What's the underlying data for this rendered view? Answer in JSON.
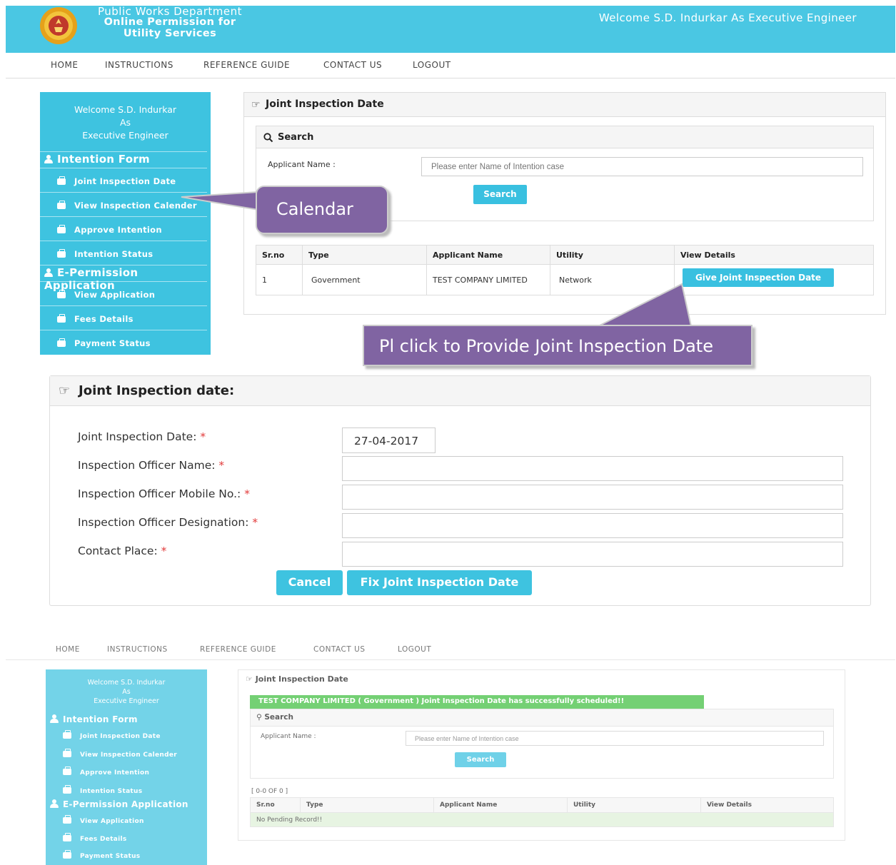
{
  "header": {
    "org_line1": "Public Works Department",
    "org_line2": "Online Permission for",
    "org_line3": "Utility Services",
    "welcome": "Welcome S.D. Indurkar As Executive Engineer"
  },
  "nav": [
    "HOME",
    "INSTRUCTIONS",
    "REFERENCE GUIDE",
    "CONTACT US",
    "LOGOUT"
  ],
  "sidebar": {
    "welcome_line1": "Welcome S.D. Indurkar",
    "welcome_line2": "As",
    "welcome_line3": "Executive Engineer",
    "intention_heading": "Intention Form",
    "intention_items": [
      "Joint Inspection Date",
      "View Inspection Calender",
      "Approve Intention",
      "Intention Status"
    ],
    "epermission_heading": "E-Permission Application",
    "epermission_items": [
      "View Application",
      "Fees Details",
      "Payment Status"
    ]
  },
  "panel": {
    "title": "Joint Inspection Date",
    "search_title": "Search",
    "applicant_label": "Applicant Name :",
    "applicant_placeholder": "Please enter Name of Intention case",
    "search_button": "Search",
    "columns": [
      "Sr.no",
      "Type",
      "Applicant Name",
      "Utility",
      "View Details"
    ],
    "rows": [
      {
        "srno": "1",
        "type": "Government",
        "applicant": "TEST COMPANY LIMITED",
        "utility": "Network",
        "action": "Give Joint Inspection Date"
      }
    ]
  },
  "callouts": {
    "calendar": "Calendar",
    "provide": "Pl click to Provide Joint Inspection Date"
  },
  "form": {
    "title": "Joint Inspection date:",
    "date_label": "Joint Inspection Date:",
    "date_value": "27-04-2017",
    "officer_name_label": "Inspection Officer Name:",
    "officer_mobile_label": "Inspection Officer Mobile No.:",
    "officer_designation_label": "Inspection Officer Designation:",
    "contact_place_label": "Contact Place:",
    "required_mark": "*",
    "cancel_button": "Cancel",
    "fix_button": "Fix Joint Inspection Date"
  },
  "result": {
    "success_message": "TEST COMPANY LIMITED ( Government ) Joint Inspection Date has successfully scheduled!!",
    "paging": "[ 0-0 OF 0 ]",
    "empty_message": "No Pending Record!!"
  },
  "colors": {
    "header_bg": "#4ac7e3",
    "sidebar_bg": "#3ec3e0",
    "button": "#39c0e0",
    "callout": "#8064a2",
    "success": "#3fbf3f",
    "required": "#e23b3b"
  }
}
